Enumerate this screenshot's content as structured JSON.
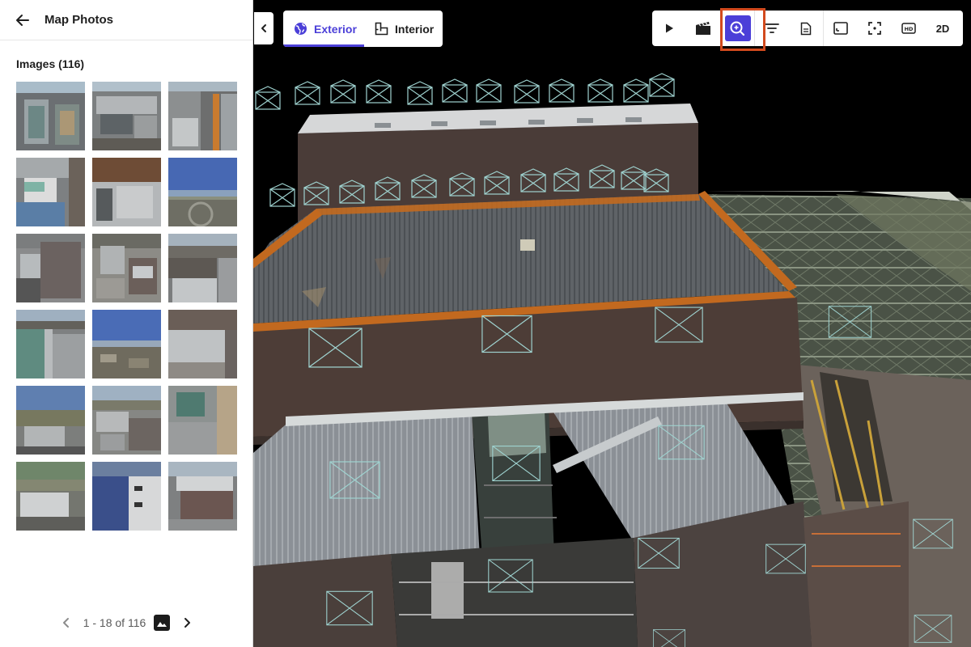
{
  "panel": {
    "title": "Map Photos",
    "images_heading": "Images (116)",
    "thumbnails_count": 18,
    "pager": {
      "range": "1 - 18 of 116"
    }
  },
  "view_tabs": [
    {
      "label": "Exterior",
      "icon": "globe-icon",
      "active": true
    },
    {
      "label": "Interior",
      "icon": "floorplan-icon",
      "active": false
    }
  ],
  "toolbar": {
    "buttons": [
      {
        "name": "play",
        "icon": "play-icon"
      },
      {
        "name": "video",
        "icon": "clapperboard-icon"
      },
      {
        "name": "inspect",
        "icon": "zoom-in-icon",
        "active": true
      },
      {
        "name": "filter",
        "icon": "filter-icon"
      },
      {
        "name": "report",
        "icon": "document-icon"
      },
      {
        "name": "picture-in-picture",
        "icon": "frame-icon"
      },
      {
        "name": "focus",
        "icon": "focus-icon"
      },
      {
        "name": "hd",
        "icon": "hd-icon",
        "label": "HD"
      },
      {
        "name": "2d",
        "label": "2D"
      }
    ]
  },
  "colors": {
    "accent": "#4b3fd8",
    "highlight": "#d24a1e",
    "marker": "#9fd3d0"
  }
}
